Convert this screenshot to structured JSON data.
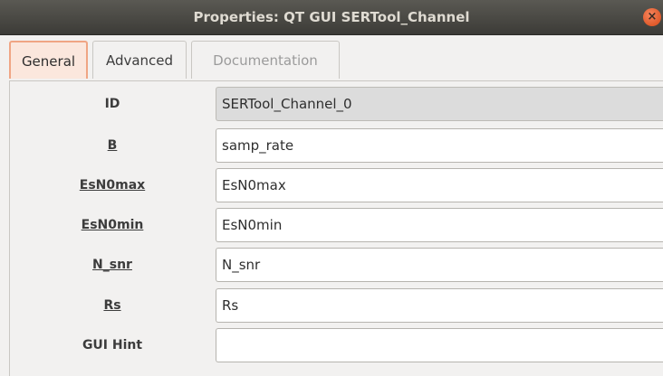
{
  "window": {
    "title": "Properties: QT GUI SERTool_Channel",
    "close_icon": "close-icon",
    "close_glyph": "×"
  },
  "tabs": [
    {
      "label": "General",
      "active": true
    },
    {
      "label": "Advanced",
      "active": false
    },
    {
      "label": "Documentation",
      "active": false,
      "disabled": true
    }
  ],
  "params": [
    {
      "label": "ID",
      "value": "SERTool_Channel_0",
      "readonly": true
    },
    {
      "label": "B",
      "value": "samp_rate"
    },
    {
      "label": "EsN0max",
      "value": "EsN0max"
    },
    {
      "label": "EsN0min",
      "value": "EsN0min"
    },
    {
      "label": "N_snr",
      "value": "N_snr"
    },
    {
      "label": "Rs",
      "value": "Rs"
    },
    {
      "label": "GUI Hint",
      "value": ""
    }
  ],
  "colors": {
    "titlebar": "#3c3b37",
    "active_tab_border": "#f0a584",
    "close_button": "#e05a2b"
  }
}
